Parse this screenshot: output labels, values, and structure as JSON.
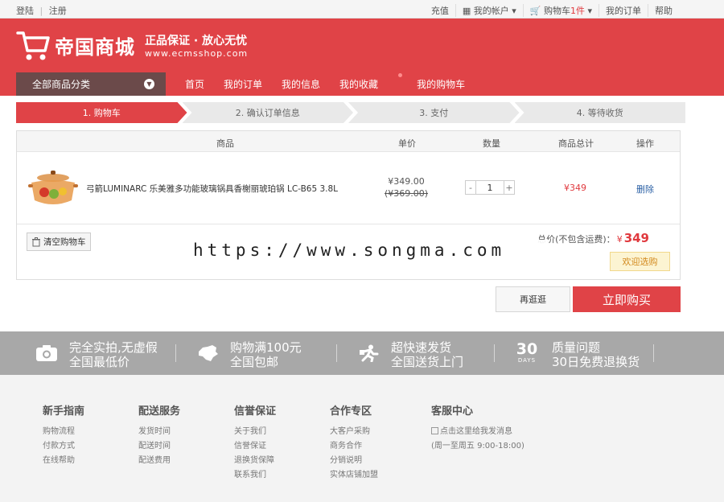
{
  "topbar": {
    "login": "登陆",
    "divider": "|",
    "register": "注册",
    "recharge": "充值",
    "account": "我的帐户",
    "cart_label": "购物车",
    "cart_count": "1件",
    "orders": "我的订单",
    "help": "帮助"
  },
  "header": {
    "brand": "帝国商城",
    "slogan": "正品保证 · 放心无忧",
    "url": "www.ecmsshop.com"
  },
  "nav": {
    "category": "全部商品分类",
    "links": [
      "首页",
      "我的订单",
      "我的信息",
      "我的收藏",
      "我的购物车"
    ]
  },
  "steps": [
    "1. 购物车",
    "2. 确认订单信息",
    "3. 支付",
    "4. 等待收货"
  ],
  "table": {
    "headers": {
      "product": "商品",
      "price": "单价",
      "qty": "数量",
      "subtotal": "商品总计",
      "action": "操作"
    },
    "row": {
      "name": "弓箭LUMINARC 乐美雅多功能玻璃锅具香榭丽琥珀锅 LC-B65 3.8L",
      "price": "¥349.00",
      "old_price": "(¥369.00)",
      "qty_minus": "-",
      "qty": "1",
      "qty_plus": "+",
      "subtotal": "¥349",
      "delete": "删除"
    },
    "clear": "清空购物车",
    "total_label": "总价(不包含运费)：",
    "currency": "¥",
    "total": "349",
    "welcome": "欢迎选购"
  },
  "watermark": "https://www.songma.com",
  "buttons": {
    "again": "再逛逛",
    "buy": "立即购买"
  },
  "promo": [
    {
      "line1": "完全实拍,无虚假",
      "line2": "全国最低价",
      "icon": "camera-icon"
    },
    {
      "line1": "购物满100元",
      "line2": "全国包邮",
      "icon": "china-map-icon"
    },
    {
      "line1": "超快速发货",
      "line2": "全国送货上门",
      "icon": "runner-icon"
    },
    {
      "line1": "质量问题",
      "line2": "30日免费退换货",
      "icon": "30-days-icon",
      "badge": "30",
      "badge_sub": "DAYS"
    }
  ],
  "footer": {
    "columns": [
      {
        "title": "新手指南",
        "items": [
          "购物流程",
          "付款方式",
          "在线帮助"
        ]
      },
      {
        "title": "配送服务",
        "items": [
          "发货时间",
          "配送时间",
          "配送费用"
        ]
      },
      {
        "title": "信誉保证",
        "items": [
          "关于我们",
          "信誉保证",
          "退换货保障",
          "联系我们"
        ]
      },
      {
        "title": "合作专区",
        "items": [
          "大客户采购",
          "商务合作",
          "分销说明",
          "实体店铺加盟"
        ]
      },
      {
        "title": "客服中心",
        "items": [
          "点击这里给我发消息",
          "(周一至周五 9:00-18:00)"
        ]
      }
    ]
  },
  "colors": {
    "brand_red": "#e04347",
    "link_blue": "#2b60a5"
  }
}
